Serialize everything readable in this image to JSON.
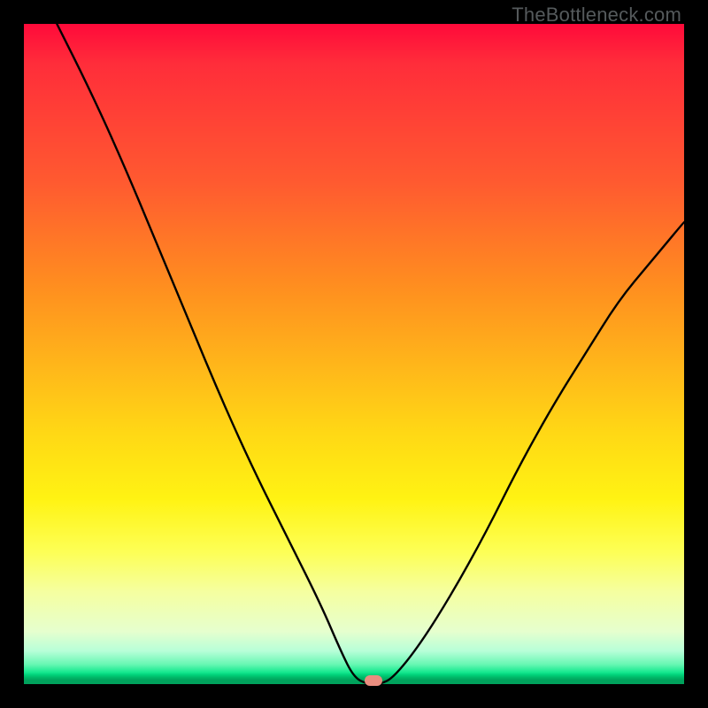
{
  "watermark": "TheBottleneck.com",
  "chart_data": {
    "type": "line",
    "title": "",
    "xlabel": "",
    "ylabel": "",
    "xlim": [
      0,
      100
    ],
    "ylim": [
      0,
      100
    ],
    "grid": false,
    "legend": false,
    "annotations": [],
    "series": [
      {
        "name": "bottleneck-curve",
        "x": [
          5,
          10,
          15,
          20,
          25,
          30,
          35,
          40,
          45,
          48,
          50,
          52,
          54,
          56,
          60,
          65,
          70,
          75,
          80,
          85,
          90,
          95,
          100
        ],
        "values": [
          100,
          90,
          79,
          67,
          55,
          43,
          32,
          22,
          12,
          5,
          1,
          0,
          0,
          1,
          6,
          14,
          23,
          33,
          42,
          50,
          58,
          64,
          70
        ]
      }
    ],
    "marker": {
      "x": 53,
      "y": 0,
      "color": "#e98d7f"
    },
    "background_gradient": {
      "direction": "vertical",
      "stops": [
        {
          "pos": 0,
          "color": "#ff0a3a"
        },
        {
          "pos": 0.4,
          "color": "#ff8f1f"
        },
        {
          "pos": 0.72,
          "color": "#fff313"
        },
        {
          "pos": 0.92,
          "color": "#e6ffce"
        },
        {
          "pos": 0.99,
          "color": "#00b868"
        },
        {
          "pos": 1.0,
          "color": "#00a25c"
        }
      ]
    }
  }
}
